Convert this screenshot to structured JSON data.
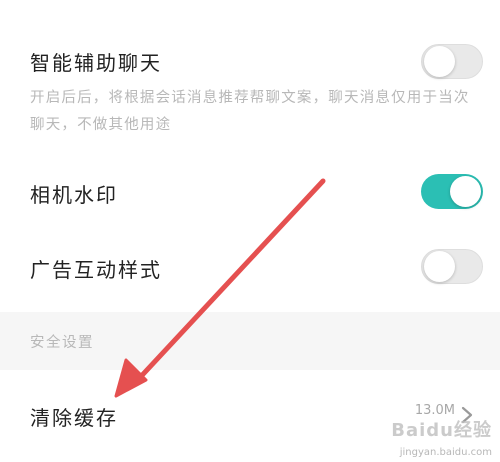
{
  "settings": {
    "smart_chat": {
      "title": "智能辅助聊天",
      "description": "开启后后，将根据会话消息推荐帮聊文案，聊天消息仅用于当次聊天，不做其他用途",
      "enabled": false
    },
    "camera_watermark": {
      "title": "相机水印",
      "enabled": true
    },
    "ad_interaction": {
      "title": "广告互动样式",
      "enabled": false
    }
  },
  "security_section": {
    "label": "安全设置"
  },
  "clear_cache": {
    "title": "清除缓存",
    "size": "13.0M"
  },
  "colors": {
    "toggle_on": "#2bbfb4",
    "toggle_off": "#e9e9e9",
    "arrow": "#e55050"
  },
  "icons": {
    "chevron": "chevron-right-icon",
    "annotation": "red-arrow"
  },
  "watermark": {
    "main": "Baidu经验",
    "sub": "jingyan.baidu.com"
  }
}
